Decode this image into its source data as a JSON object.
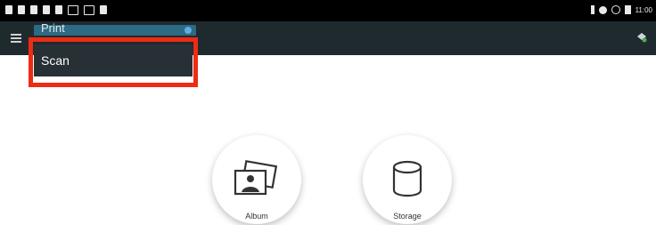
{
  "status_bar": {
    "time": "11:00"
  },
  "toolbar": {
    "mode_selected": "Print",
    "menu_icon": "menu-icon",
    "right_icon": "wifi-direct-icon"
  },
  "dropdown": {
    "items": [
      {
        "label": "Scan"
      }
    ]
  },
  "sources": [
    {
      "label": "Album",
      "icon": "album-icon"
    },
    {
      "label": "Storage",
      "icon": "storage-icon"
    }
  ],
  "colors": {
    "toolbar": "#1f2a2f",
    "select_accent": "#2d6a83",
    "highlight": "#ee2b14"
  }
}
